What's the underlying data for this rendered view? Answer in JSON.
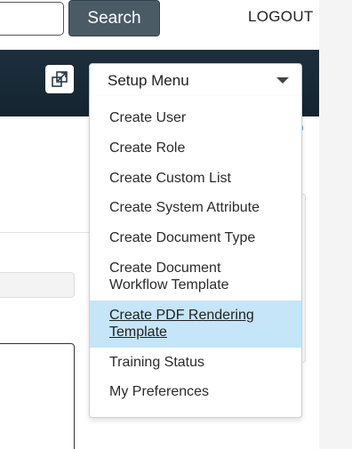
{
  "header": {
    "search_value": "",
    "search_button_label": "Search",
    "logout_label": "LOGOUT"
  },
  "nav": {
    "expand_icon": "expand-window-icon",
    "setup_menu_label": "Setup Menu",
    "setup_menu_caret_icon": "caret-down-icon"
  },
  "setup_menu": {
    "items": [
      {
        "label": "Create User"
      },
      {
        "label": "Create Role"
      },
      {
        "label": "Create Custom List"
      },
      {
        "label": "Create System Attribute"
      },
      {
        "label": "Create Document Type"
      },
      {
        "label": "Create Document Workflow Template"
      },
      {
        "label": "Create PDF Rendering Template"
      },
      {
        "label": "Training Status"
      },
      {
        "label": "My Preferences"
      }
    ],
    "highlighted_label": "Create PDF Rendering Template"
  },
  "colors": {
    "nav_background": "#1b2c39",
    "search_button": "#4a5b66",
    "menu_highlight": "#c5e5f8",
    "accent_blue": "#5ea6d6"
  }
}
